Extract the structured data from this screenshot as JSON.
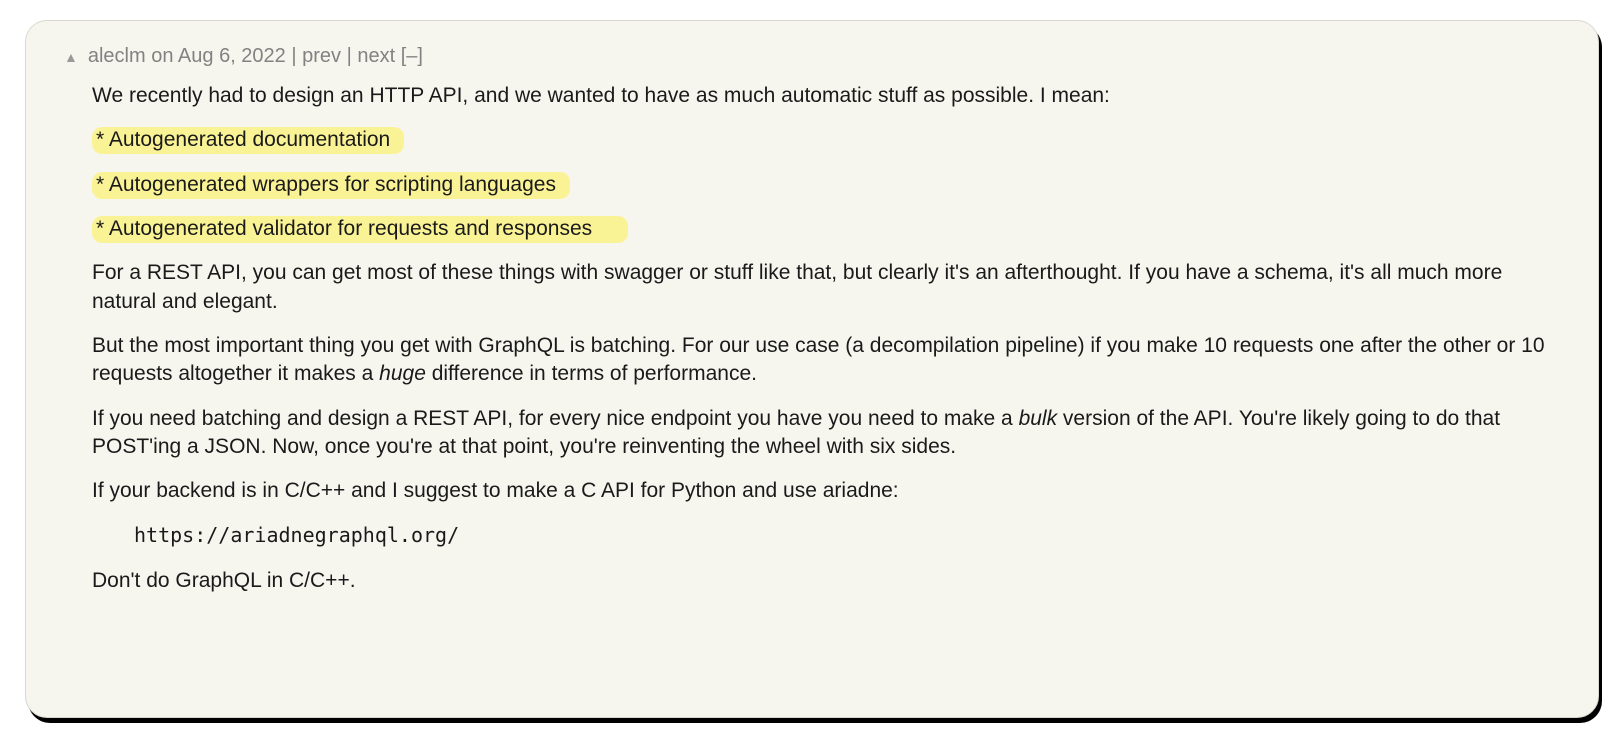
{
  "header": {
    "username": "aleclm",
    "joiner_on": "on",
    "date": "Aug 6, 2022",
    "prev": "prev",
    "next": "next",
    "toggle": "[–]"
  },
  "body": {
    "p1": "We recently had to design an HTTP API, and we wanted to have as much automatic stuff as possible. I mean:",
    "b1": "* Autogenerated documentation",
    "b2": "* Autogenerated wrappers for scripting languages",
    "b3": "* Autogenerated validator for requests and responses",
    "p2": "For a REST API, you can get most of these things with swagger or stuff like that, but clearly it's an afterthought. If you have a schema, it's all much more natural and elegant.",
    "p3a": "But the most important thing you get with GraphQL is batching. For our use case (a decompilation pipeline) if you make 10 requests one after the other or 10 requests altogether it makes a ",
    "p3em": "huge",
    "p3b": " difference in terms of performance.",
    "p4a": "If you need batching and design a REST API, for every nice endpoint you have you need to make a ",
    "p4em": "bulk",
    "p4b": " version of the API. You're likely going to do that POST'ing a JSON. Now, once you're at that point, you're reinventing the wheel with six sides.",
    "p5": "If your backend is in C/C++ and I suggest to make a C API for Python and use ariadne:",
    "code": "https://ariadnegraphql.org/",
    "p6": "Don't do GraphQL in C/C++."
  }
}
